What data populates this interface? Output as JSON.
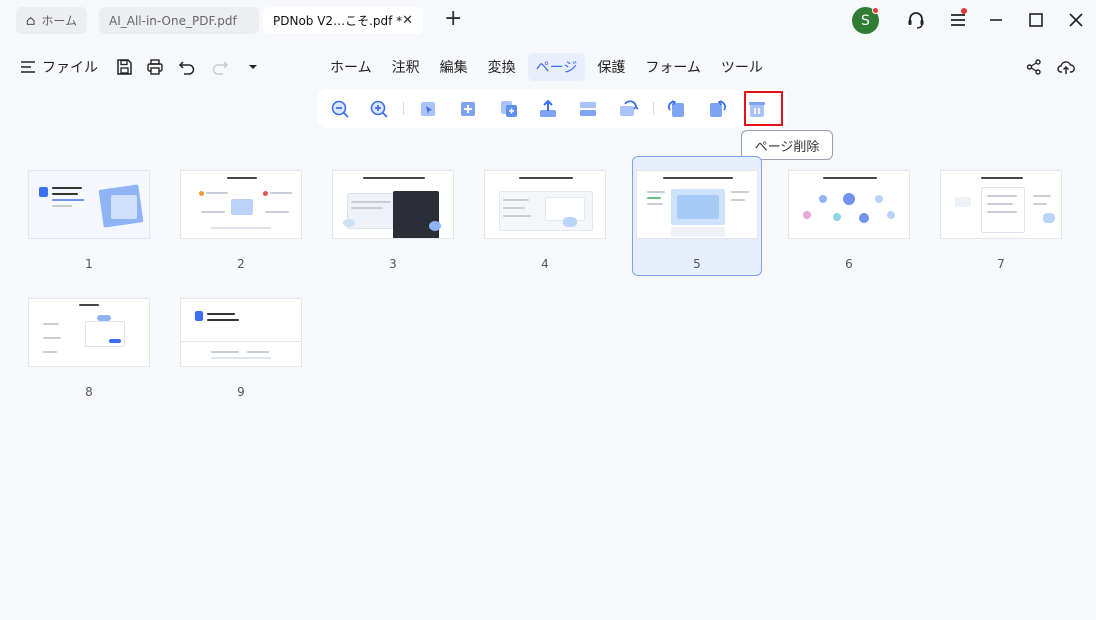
{
  "titlebar": {
    "tabs": [
      {
        "label": "ホーム",
        "icon": "home-icon"
      },
      {
        "label": "AI_All-in-One_PDF.pdf"
      },
      {
        "label": "PDNob V2…こそ.pdf *",
        "close": "✕"
      }
    ],
    "new_tab": "+",
    "avatar_letter": "S",
    "icons": [
      "headset-icon",
      "menu-icon",
      "minimize-icon",
      "maximize-icon",
      "close-icon"
    ]
  },
  "menubar": {
    "file_label": "ファイル",
    "quick_icons": [
      "save-icon",
      "print-icon",
      "undo-icon",
      "redo-icon",
      "dropdown-icon"
    ],
    "tabs": [
      "ホーム",
      "注釈",
      "編集",
      "変換",
      "ページ",
      "保護",
      "フォーム",
      "ツール"
    ],
    "active_tab": "ページ",
    "right_icons": [
      "share-icon",
      "cloud-upload-icon"
    ]
  },
  "page_toolbar": {
    "tools": [
      "zoom-out-icon",
      "zoom-in-icon",
      "select-page-icon",
      "insert-page-icon",
      "replace-page-icon",
      "extract-page-icon",
      "split-page-icon",
      "rotate-page-icon",
      "rotate-left-icon",
      "rotate-right-icon",
      "delete-page-icon"
    ],
    "tooltip": "ページ削除"
  },
  "pages": {
    "numbers": [
      "1",
      "2",
      "3",
      "4",
      "5",
      "6",
      "7",
      "8",
      "9"
    ],
    "selected": "5"
  },
  "colors": {
    "accent": "#3b6ef0",
    "highlight": "#e3131b",
    "avatar": "#2e7d32",
    "selection_bg": "#e6edfb"
  }
}
